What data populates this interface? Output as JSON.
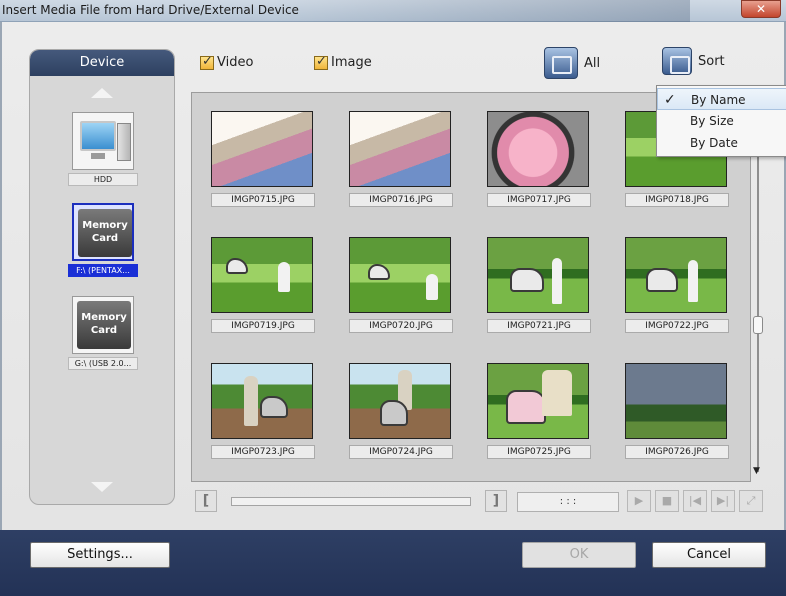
{
  "window": {
    "title": "Insert Media File from Hard Drive/External Device",
    "close_label": "✕"
  },
  "device_panel": {
    "header": "Device",
    "items": [
      {
        "label": "HDD",
        "icon": "hdd-icon",
        "selected": false
      },
      {
        "label": "F:\\ (PENTAX...",
        "icon": "memory-card-icon",
        "icon_text": "Memory Card",
        "selected": true
      },
      {
        "label": "G:\\ (USB 2.0...",
        "icon": "memory-card-icon",
        "icon_text": "Memory Card",
        "selected": false
      }
    ]
  },
  "filters": {
    "video_label": "Video",
    "image_label": "Image",
    "all_label": "All",
    "sort_label": "Sort"
  },
  "sort_menu": {
    "items": [
      {
        "label": "By Name",
        "checked": true
      },
      {
        "label": "By Size",
        "checked": false
      },
      {
        "label": "By Date",
        "checked": false
      }
    ]
  },
  "thumbnails": [
    {
      "name": "IMGP0715.JPG",
      "scene": "baby"
    },
    {
      "name": "IMGP0716.JPG",
      "scene": "baby"
    },
    {
      "name": "IMGP0717.JPG",
      "scene": "pram"
    },
    {
      "name": "IMGP0718.JPG",
      "scene": "park"
    },
    {
      "name": "IMGP0719.JPG",
      "scene": "park"
    },
    {
      "name": "IMGP0720.JPG",
      "scene": "park"
    },
    {
      "name": "IMGP0721.JPG",
      "scene": "park2"
    },
    {
      "name": "IMGP0722.JPG",
      "scene": "park2"
    },
    {
      "name": "IMGP0723.JPG",
      "scene": "road"
    },
    {
      "name": "IMGP0724.JPG",
      "scene": "road"
    },
    {
      "name": "IMGP0725.JPG",
      "scene": "park2"
    },
    {
      "name": "IMGP0726.JPG",
      "scene": "sky"
    }
  ],
  "transport": {
    "start_bracket": "[",
    "end_bracket": "]",
    "time": ":   :   :",
    "play_icon": "▶",
    "stop_icon": "■",
    "prev_icon": "|◀",
    "next_icon": "▶|",
    "fullscreen_icon": "⤢"
  },
  "footer": {
    "settings_label": "Settings...",
    "ok_label": "OK",
    "cancel_label": "Cancel"
  }
}
